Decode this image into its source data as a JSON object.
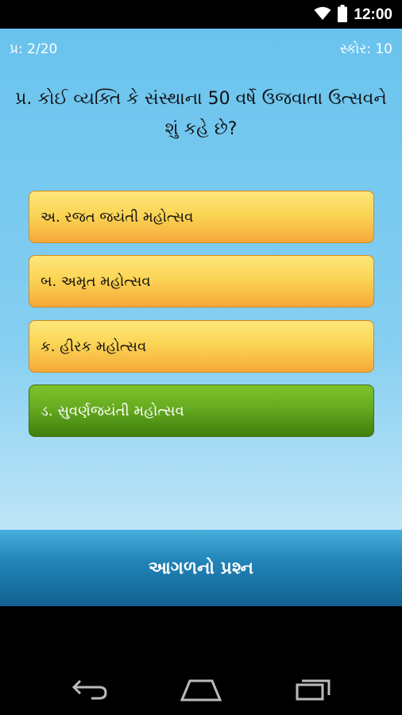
{
  "status_bar": {
    "time": "12:00",
    "icons": [
      "wifi-icon",
      "battery-icon"
    ]
  },
  "quiz": {
    "question_counter": "પ્ર: 2/20",
    "score": "સ્કોર: 10",
    "question": "પ્ર. કોઈ વ્યક્તિ કે સંસ્થાના 50 વર્ષે ઉજવાતા ઉત્સવને શું કહે છે?",
    "options": [
      {
        "label": "અ. રજત જયંતી મહોત્સવ",
        "state": "default"
      },
      {
        "label": "બ. અમૃત મહોત્સવ",
        "state": "default"
      },
      {
        "label": "ક. હીરક મહોત્સવ",
        "state": "default"
      },
      {
        "label": "ડ. સુવર્ણજયંતી મહોત્સવ",
        "state": "correct"
      }
    ],
    "next_button": "આગળનો પ્રશ્ન"
  },
  "nav_bar": {
    "icons": [
      "back-icon",
      "home-icon",
      "recent-apps-icon"
    ]
  },
  "colors": {
    "background_top": "#69c3ee",
    "option_default": "#fbd555",
    "option_correct": "#66ab1f",
    "next_button": "#2284b9"
  }
}
